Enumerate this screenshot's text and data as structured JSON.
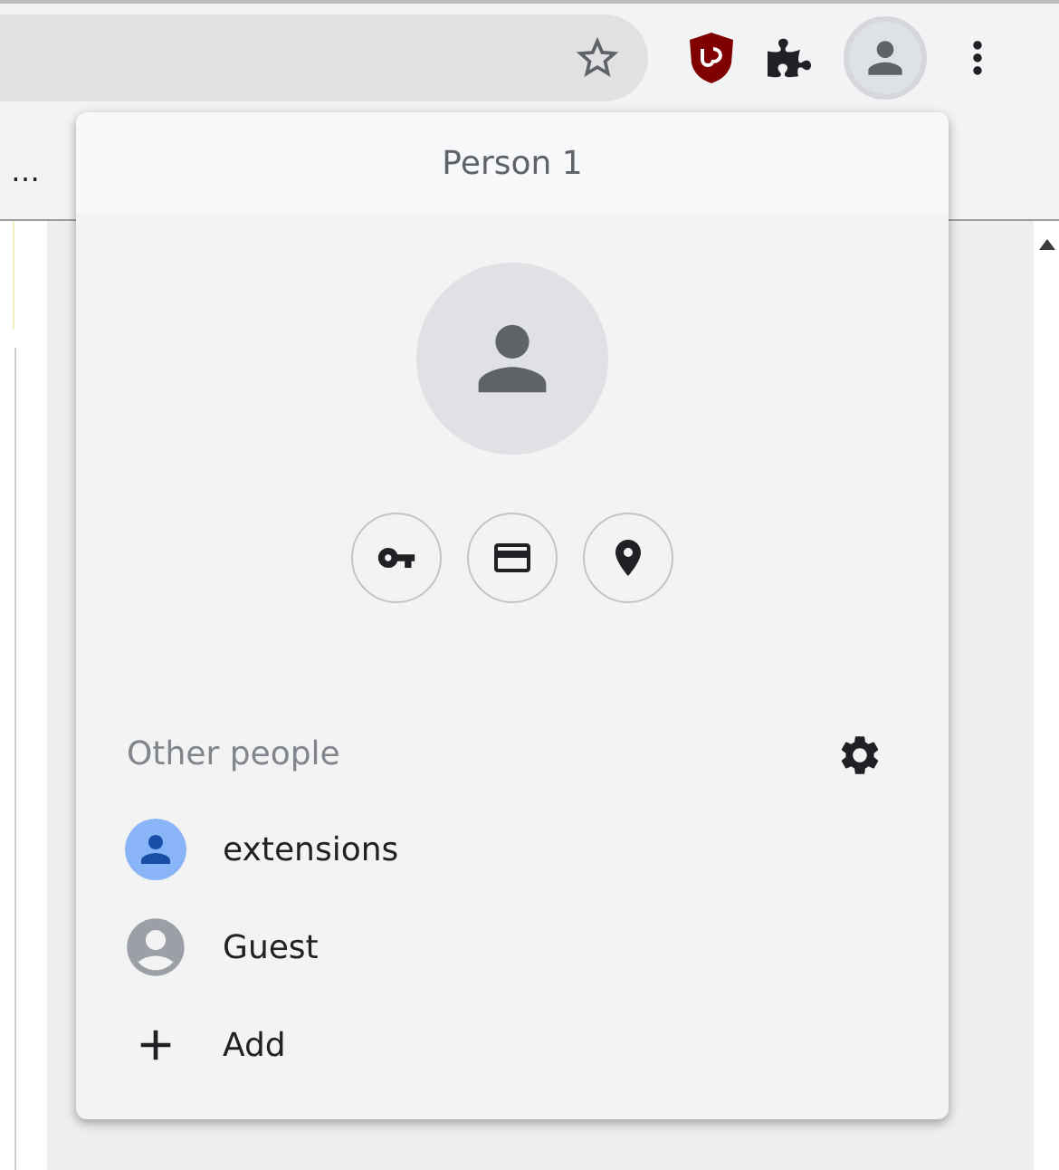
{
  "bookmarks_bar": {
    "overflow": "…"
  },
  "profile_menu": {
    "name": "Person 1",
    "other_people_heading": "Other people",
    "people": [
      {
        "kind": "profile",
        "label": "extensions"
      },
      {
        "kind": "guest",
        "label": "Guest"
      },
      {
        "kind": "add",
        "label": "Add"
      }
    ]
  }
}
